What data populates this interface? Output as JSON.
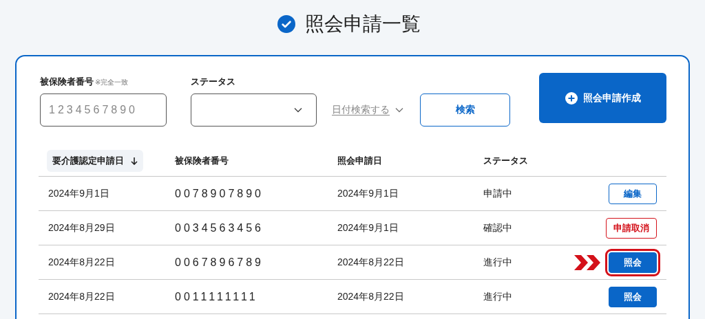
{
  "page_title": "照会申請一覧",
  "filters": {
    "insured_label": "被保険者番号",
    "insured_note": "※完全一致",
    "insured_placeholder": "1234567890",
    "status_label": "ステータス",
    "date_toggle": "日付検索する",
    "search_button": "検索"
  },
  "create_button": "照会申請作成",
  "table": {
    "columns": [
      {
        "label": "要介護認定申請日",
        "sorted": true
      },
      {
        "label": "被保険者番号",
        "sorted": false
      },
      {
        "label": "照会申請日",
        "sorted": false
      },
      {
        "label": "ステータス",
        "sorted": false
      }
    ],
    "rows": [
      {
        "cells": [
          "2024年9月1日",
          "0078907890",
          "2024年9月1日",
          "申請中"
        ],
        "action": {
          "kind": "edit",
          "label": "編集",
          "highlighted": false
        }
      },
      {
        "cells": [
          "2024年8月29日",
          "0034563456",
          "2024年9月1日",
          "確認中"
        ],
        "action": {
          "kind": "cancel",
          "label": "申請取消",
          "highlighted": false
        }
      },
      {
        "cells": [
          "2024年8月22日",
          "0067896789",
          "2024年8月22日",
          "進行中"
        ],
        "action": {
          "kind": "view",
          "label": "照会",
          "highlighted": true
        }
      },
      {
        "cells": [
          "2024年8月22日",
          "0011111111",
          "2024年8月22日",
          "進行中"
        ],
        "action": {
          "kind": "view",
          "label": "照会",
          "highlighted": false
        }
      }
    ]
  }
}
